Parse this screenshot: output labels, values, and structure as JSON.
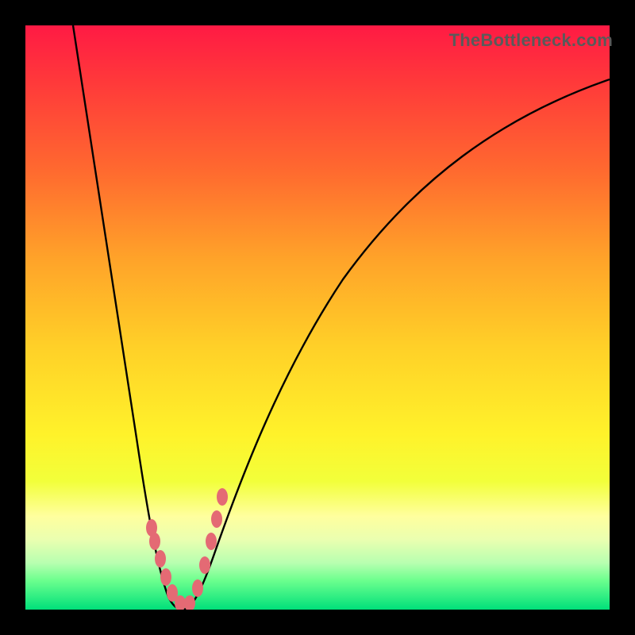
{
  "watermark": "TheBottleneck.com",
  "chart_data": {
    "type": "line",
    "title": "",
    "xlabel": "",
    "ylabel": "",
    "xlim": [
      0,
      100
    ],
    "ylim": [
      0,
      100
    ],
    "series": [
      {
        "name": "left-curve",
        "x": [
          8,
          10,
          12,
          14,
          16,
          17,
          18,
          19,
          20,
          21,
          22,
          23,
          24,
          25
        ],
        "values": [
          100,
          85,
          70,
          55,
          40,
          32,
          25,
          18,
          12,
          8,
          5,
          3,
          1,
          0
        ]
      },
      {
        "name": "right-curve",
        "x": [
          25,
          27,
          30,
          34,
          40,
          48,
          58,
          70,
          84,
          100
        ],
        "values": [
          0,
          5,
          15,
          28,
          44,
          58,
          70,
          80,
          87,
          92
        ]
      }
    ],
    "markers": {
      "name": "data-points",
      "x": [
        20.5,
        21.0,
        22.0,
        23.0,
        24.0,
        25.0,
        26.0,
        27.0,
        28.0,
        29.0,
        30.0,
        31.0
      ],
      "values": [
        14,
        12,
        9,
        6,
        3,
        1,
        1,
        4,
        8,
        12,
        16,
        20
      ]
    },
    "background_gradient": {
      "top": "#ff1a44",
      "bottom": "#00e07a"
    }
  }
}
